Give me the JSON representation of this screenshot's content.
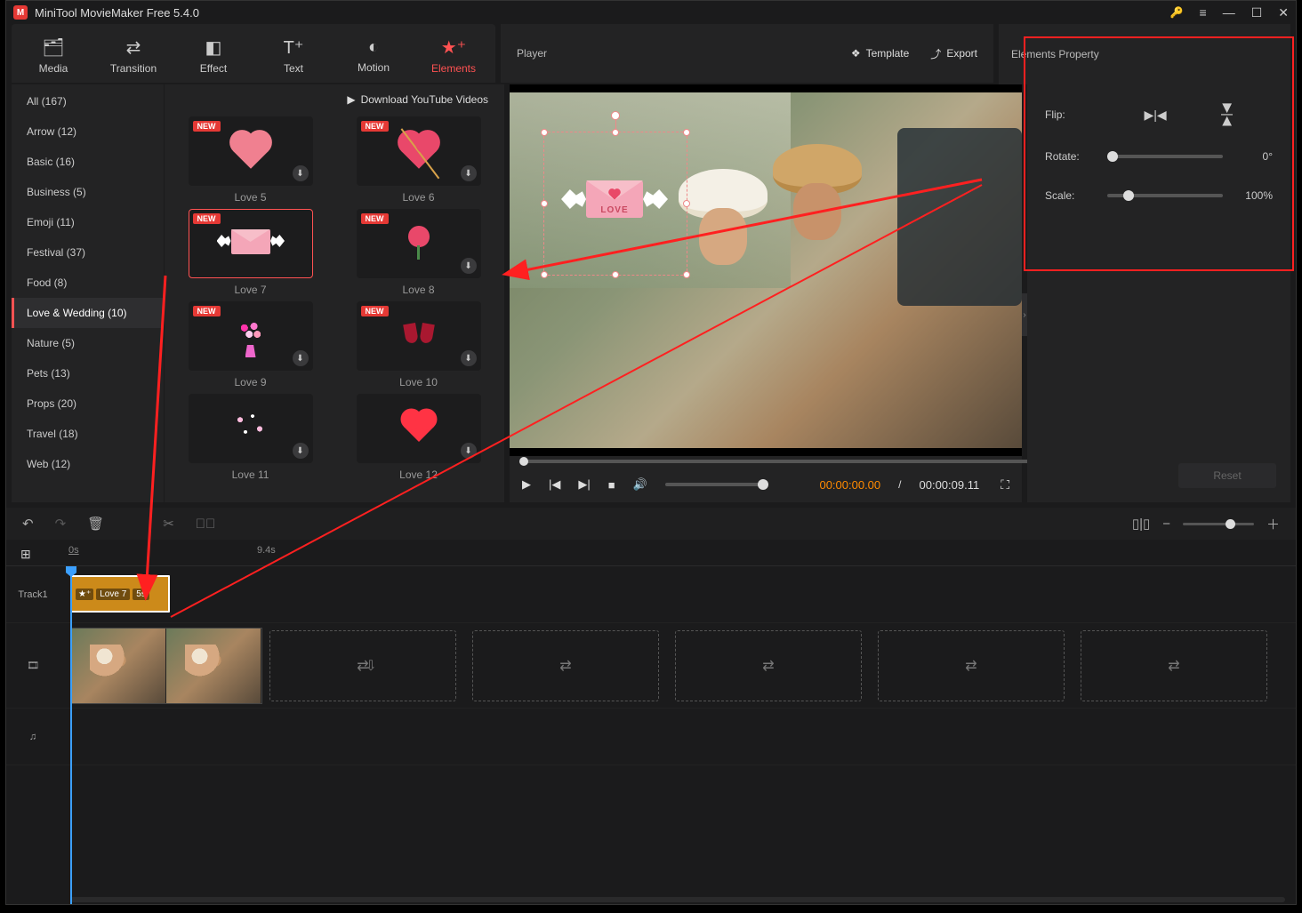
{
  "app": {
    "title": "MiniTool MovieMaker Free 5.4.0"
  },
  "tabs": {
    "media": "Media",
    "transition": "Transition",
    "effect": "Effect",
    "text": "Text",
    "motion": "Motion",
    "elements": "Elements"
  },
  "categories": [
    {
      "label": "All (167)"
    },
    {
      "label": "Arrow (12)"
    },
    {
      "label": "Basic (16)"
    },
    {
      "label": "Business (5)"
    },
    {
      "label": "Emoji (11)"
    },
    {
      "label": "Festival (37)"
    },
    {
      "label": "Food (8)"
    },
    {
      "label": "Love & Wedding (10)",
      "active": true
    },
    {
      "label": "Nature (5)"
    },
    {
      "label": "Pets (13)"
    },
    {
      "label": "Props (20)"
    },
    {
      "label": "Travel (18)"
    },
    {
      "label": "Web (12)"
    }
  ],
  "download_yt": "Download YouTube Videos",
  "new_badge": "NEW",
  "assets": [
    {
      "label": "Love 5"
    },
    {
      "label": "Love 6"
    },
    {
      "label": "Love 7",
      "selected": true
    },
    {
      "label": "Love 8"
    },
    {
      "label": "Love 9"
    },
    {
      "label": "Love 10"
    },
    {
      "label": "Love 11"
    },
    {
      "label": "Love 12"
    }
  ],
  "player": {
    "label": "Player",
    "template": "Template",
    "export": "Export",
    "time_current": "00:00:00.00",
    "time_separator": "/",
    "time_duration": "00:00:09.11",
    "element_text": "LOVE"
  },
  "props": {
    "title": "Elements Property",
    "flip": "Flip:",
    "rotate": "Rotate:",
    "rotate_val": "0°",
    "scale": "Scale:",
    "scale_val": "100%",
    "reset": "Reset"
  },
  "timeline": {
    "t0": "0s",
    "t1": "9.4s",
    "track1": "Track1",
    "clip": {
      "name": "Love 7",
      "duration": "5s"
    },
    "drop_icons": [
      "⇄",
      "⇩",
      "⇄",
      "⇄",
      "⇄",
      "⇄"
    ]
  }
}
